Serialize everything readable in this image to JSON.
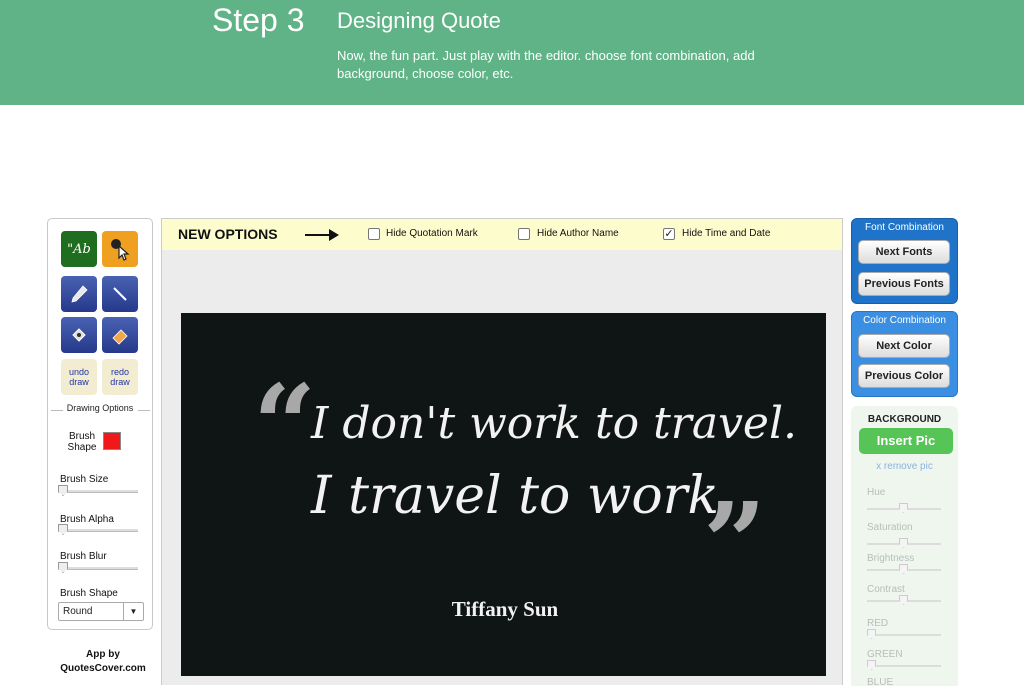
{
  "header": {
    "step": "Step 3",
    "title": "Designing Quote",
    "description": "Now, the fun part. Just play with the editor. choose font combination, add background, choose color, etc."
  },
  "tools": {
    "text_tool": "\"Ab",
    "undo": "undo draw",
    "redo": "redo draw",
    "drawing_options": "Drawing Options",
    "brush_shape_color_label": "Brush Shape",
    "brush_color": "#f01818",
    "brush_size": "Brush Size",
    "brush_alpha": "Brush Alpha",
    "brush_blur": "Brush Blur",
    "brush_shape": "Brush Shape",
    "brush_shape_value": "Round"
  },
  "app_by": "App by QuotesCover.com",
  "options_bar": {
    "title": "NEW OPTIONS",
    "hide_quotation": {
      "label": "Hide Quotation Mark",
      "checked": false
    },
    "hide_author": {
      "label": "Hide Author Name",
      "checked": false
    },
    "hide_time": {
      "label": "Hide Time and Date",
      "checked": true
    }
  },
  "quote": {
    "line1": "I don't work to travel.",
    "line2": "I travel to work.",
    "author": "Tiffany Sun",
    "open_mark": "“",
    "close_mark": "”"
  },
  "font_combination": {
    "title": "Font Combination",
    "next": "Next Fonts",
    "previous": "Previous Fonts"
  },
  "color_combination": {
    "title": "Color Combination",
    "next": "Next Color",
    "previous": "Previous Color"
  },
  "background": {
    "title": "BACKGROUND",
    "insert": "Insert Pic",
    "remove": "x remove pic",
    "hue": "Hue",
    "saturation": "Saturation",
    "brightness": "Brightness",
    "contrast": "Contrast",
    "red": "RED",
    "green": "GREEN",
    "blue": "BLUE"
  }
}
